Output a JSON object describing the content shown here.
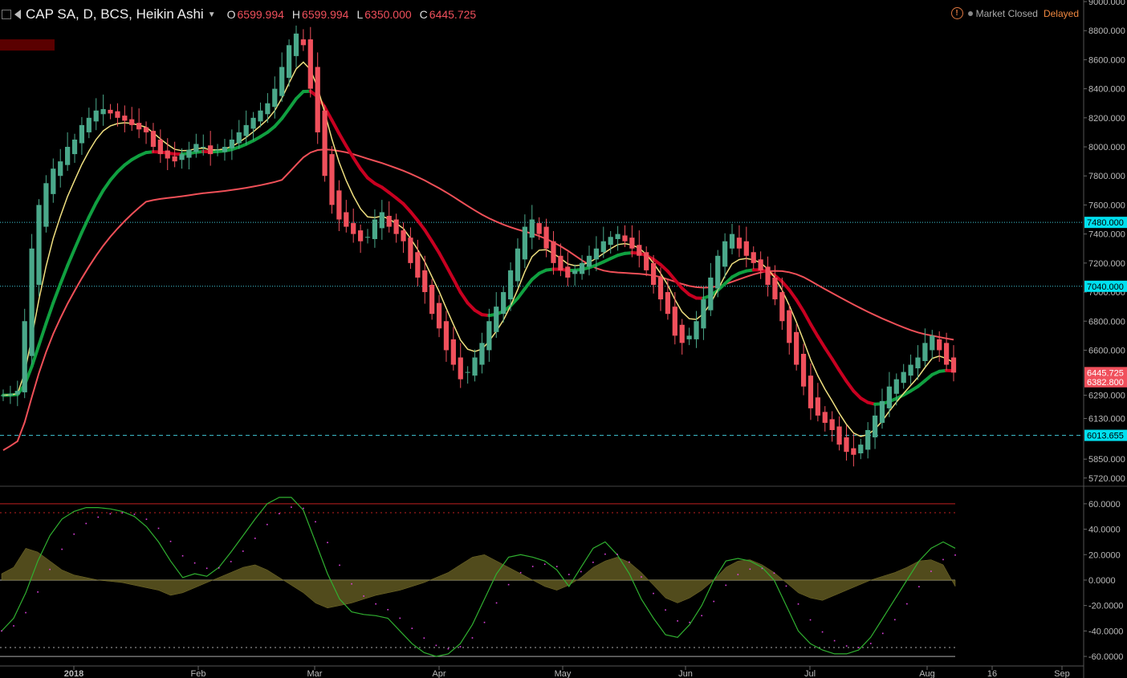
{
  "header": {
    "symbol": "CAP SA, D, BCS, Heikin Ashi",
    "open_label": "O",
    "open_value": "6599.994",
    "high_label": "H",
    "high_value": "6599.994",
    "low_label": "L",
    "low_value": "6350.000",
    "close_label": "C",
    "close_value": "6445.725",
    "warning_icon": "warning-circle-icon",
    "market_status": "Market Closed",
    "delay_status": "Delayed"
  },
  "chart_data": [
    {
      "type": "candlestick",
      "title": "CAP SA, D, BCS, Heikin Ashi",
      "y_range": [
        5680,
        9000
      ],
      "y_axis_ticks": [
        "9000.000",
        "8800.000",
        "8600.000",
        "8400.000",
        "8200.000",
        "8000.000",
        "7800.000",
        "7600.000",
        "7400.000",
        "7200.000",
        "7000.000",
        "6800.000",
        "6600.000",
        "6290.000",
        "6130.000",
        "5850.000",
        "5720.000"
      ],
      "x_axis_ticks": [
        "2018",
        "Feb",
        "Mar",
        "Apr",
        "May",
        "Jun",
        "Jul",
        "Aug",
        "16",
        "Sep"
      ],
      "price_markers": [
        {
          "label": "7480.000",
          "value": 7480,
          "color": "#00e0f0"
        },
        {
          "label": "7040.000",
          "value": 7040,
          "color": "#00e0f0"
        },
        {
          "label": "6445.725",
          "value": 6445.725,
          "color": "#f0505c"
        },
        {
          "label": "6382.800",
          "value": 6382.8,
          "color": "#f0505c"
        },
        {
          "label": "6013.655",
          "value": 6013.655,
          "color": "#00e0f0"
        }
      ],
      "horizontal_lines": [
        {
          "value": 7480,
          "style": "dotted",
          "color": "#40c8d8"
        },
        {
          "value": 7040,
          "style": "dotted",
          "color": "#40c8d8"
        },
        {
          "value": 6013.655,
          "style": "dashed",
          "color": "#40c8d8"
        }
      ],
      "colors": {
        "up": "#4aa88a",
        "down": "#f0505c",
        "ema_fast": "#f0e080",
        "ema_mid_up": "#10a040",
        "ema_mid_down": "#c80020",
        "ma_slow": "#f05058"
      },
      "close_series": [
        6290,
        6300,
        6320,
        6800,
        7300,
        7600,
        7750,
        7850,
        7900,
        8000,
        8050,
        8150,
        8200,
        8250,
        8260,
        8230,
        8200,
        8180,
        8150,
        8120,
        8100,
        8000,
        7950,
        7920,
        7900,
        7950,
        7980,
        8020,
        8000,
        7950,
        7980,
        8000,
        8050,
        8100,
        8150,
        8200,
        8250,
        8300,
        8400,
        8550,
        8700,
        8780,
        8700,
        8400,
        8100,
        7800,
        7600,
        7500,
        7450,
        7400,
        7350,
        7380,
        7500,
        7550,
        7450,
        7400,
        7350,
        7200,
        7100,
        7000,
        6850,
        6750,
        6600,
        6500,
        6400,
        6450,
        6550,
        6650,
        6800,
        6900,
        7000,
        7150,
        7300,
        7450,
        7500,
        7400,
        7300,
        7200,
        7150,
        7100,
        7150,
        7200,
        7250,
        7300,
        7350,
        7380,
        7400,
        7350,
        7300,
        7250,
        7150,
        7050,
        6950,
        6850,
        6700,
        6650,
        6700,
        6800,
        6950,
        7100,
        7250,
        7350,
        7400,
        7300,
        7250,
        7200,
        7150,
        7050,
        6950,
        6800,
        6650,
        6500,
        6350,
        6200,
        6150,
        6100,
        6050,
        5950,
        5900,
        5880,
        5950,
        6050,
        6150,
        6250,
        6350,
        6400,
        6450,
        6500,
        6550,
        6650,
        6700,
        6600,
        6500,
        6445.725
      ]
    },
    {
      "type": "line",
      "title": "",
      "y_range": [
        -65,
        70
      ],
      "y_axis_ticks": [
        "60.0000",
        "40.0000",
        "20.0000",
        "0.0000",
        "-20.0000",
        "-40.0000",
        "-60.0000"
      ],
      "reference_lines": [
        60,
        53,
        -53,
        -60
      ],
      "colors": {
        "oscillator": "#30b030",
        "signal": "#e040e0",
        "histogram": "#5a5420"
      },
      "oscillator_series": [
        -40,
        -30,
        -10,
        15,
        35,
        48,
        54,
        57,
        57,
        56,
        54,
        50,
        42,
        30,
        15,
        2,
        5,
        3,
        10,
        22,
        35,
        48,
        60,
        65,
        65,
        55,
        30,
        5,
        -15,
        -25,
        -27,
        -28,
        -30,
        -40,
        -50,
        -57,
        -60,
        -58,
        -50,
        -35,
        -15,
        5,
        18,
        20,
        18,
        15,
        8,
        -5,
        10,
        25,
        30,
        20,
        5,
        -15,
        -30,
        -43,
        -45,
        -35,
        -20,
        0,
        15,
        17,
        15,
        10,
        0,
        -20,
        -40,
        -50,
        -55,
        -58,
        -58,
        -55,
        -45,
        -30,
        -15,
        0,
        15,
        25,
        30,
        25
      ],
      "histogram_series": [
        5,
        10,
        25,
        22,
        15,
        8,
        4,
        2,
        0,
        -1,
        -2,
        -4,
        -6,
        -8,
        -12,
        -10,
        -6,
        -2,
        2,
        6,
        10,
        12,
        8,
        2,
        -4,
        -10,
        -18,
        -22,
        -20,
        -18,
        -15,
        -12,
        -10,
        -8,
        -5,
        -2,
        2,
        6,
        12,
        18,
        20,
        15,
        10,
        5,
        0,
        -5,
        -8,
        -4,
        2,
        10,
        15,
        18,
        14,
        6,
        -4,
        -14,
        -18,
        -14,
        -8,
        0,
        10,
        15,
        16,
        12,
        6,
        -2,
        -10,
        -14,
        -16,
        -12,
        -8,
        -4,
        0,
        3,
        6,
        10,
        15,
        16,
        12,
        -5
      ]
    }
  ]
}
